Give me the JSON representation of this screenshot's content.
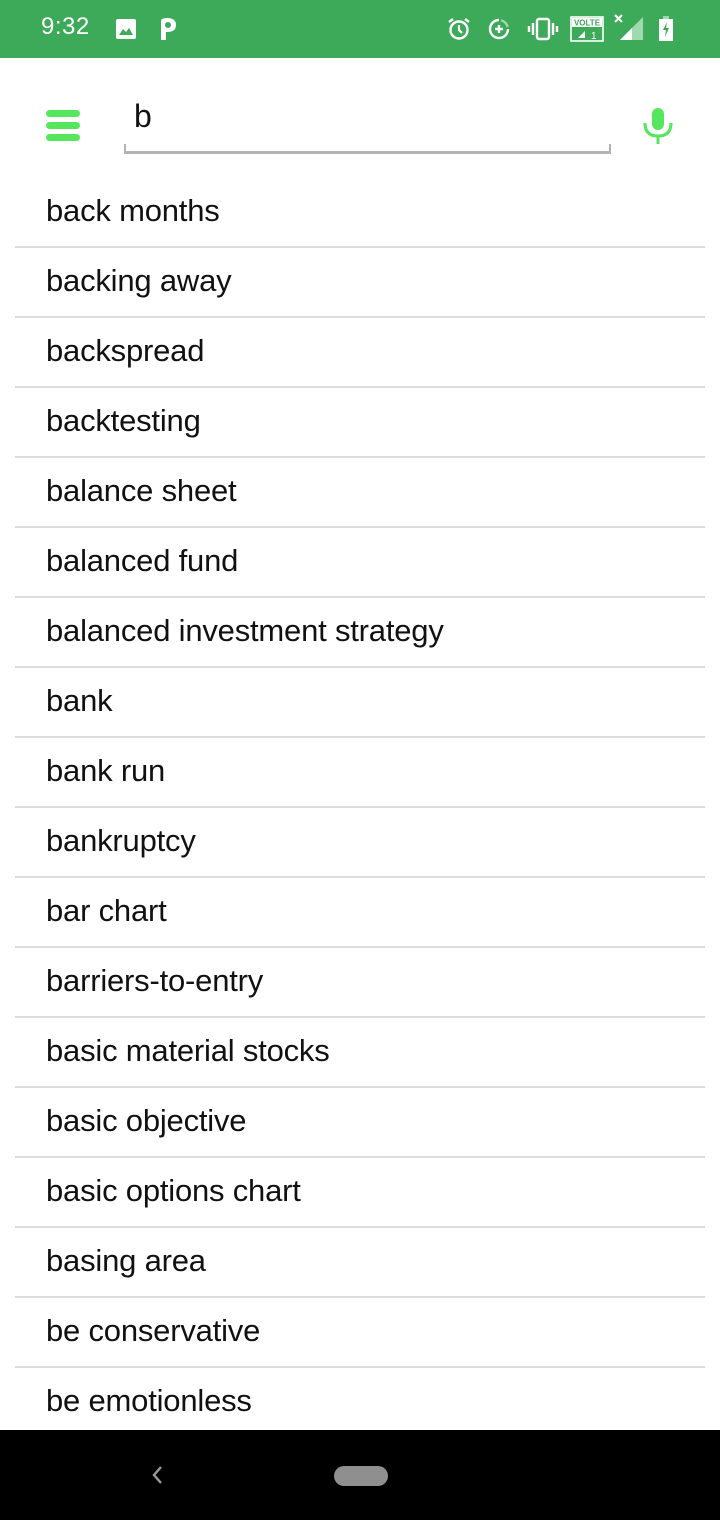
{
  "status_bar": {
    "time": "9:32",
    "left_icons": [
      "gallery-icon",
      "parking-app-icon"
    ],
    "right_icons": [
      "alarm-icon",
      "data-saver-icon",
      "vibrate-icon",
      "volte-icon",
      "signal-icon",
      "battery-charging-icon"
    ],
    "volte_label": "VOLTE",
    "sim_number": "1",
    "background_color": "#3daa5a"
  },
  "toolbar": {
    "menu_icon": "hamburger-menu-icon",
    "search_value": "b",
    "search_placeholder": "",
    "mic_icon": "microphone-icon",
    "accent_color": "#55e65c"
  },
  "results": [
    {
      "label": "back months"
    },
    {
      "label": "backing away"
    },
    {
      "label": "backspread"
    },
    {
      "label": "backtesting"
    },
    {
      "label": "balance sheet"
    },
    {
      "label": "balanced fund"
    },
    {
      "label": "balanced investment strategy"
    },
    {
      "label": "bank"
    },
    {
      "label": "bank run"
    },
    {
      "label": "bankruptcy"
    },
    {
      "label": "bar chart"
    },
    {
      "label": "barriers-to-entry"
    },
    {
      "label": "basic material stocks"
    },
    {
      "label": "basic objective"
    },
    {
      "label": "basic options chart"
    },
    {
      "label": "basing area"
    },
    {
      "label": "be conservative"
    },
    {
      "label": "be emotionless"
    }
  ],
  "nav_bar": {
    "back_icon": "back-chevron-icon",
    "home_icon": "home-pill-icon"
  }
}
